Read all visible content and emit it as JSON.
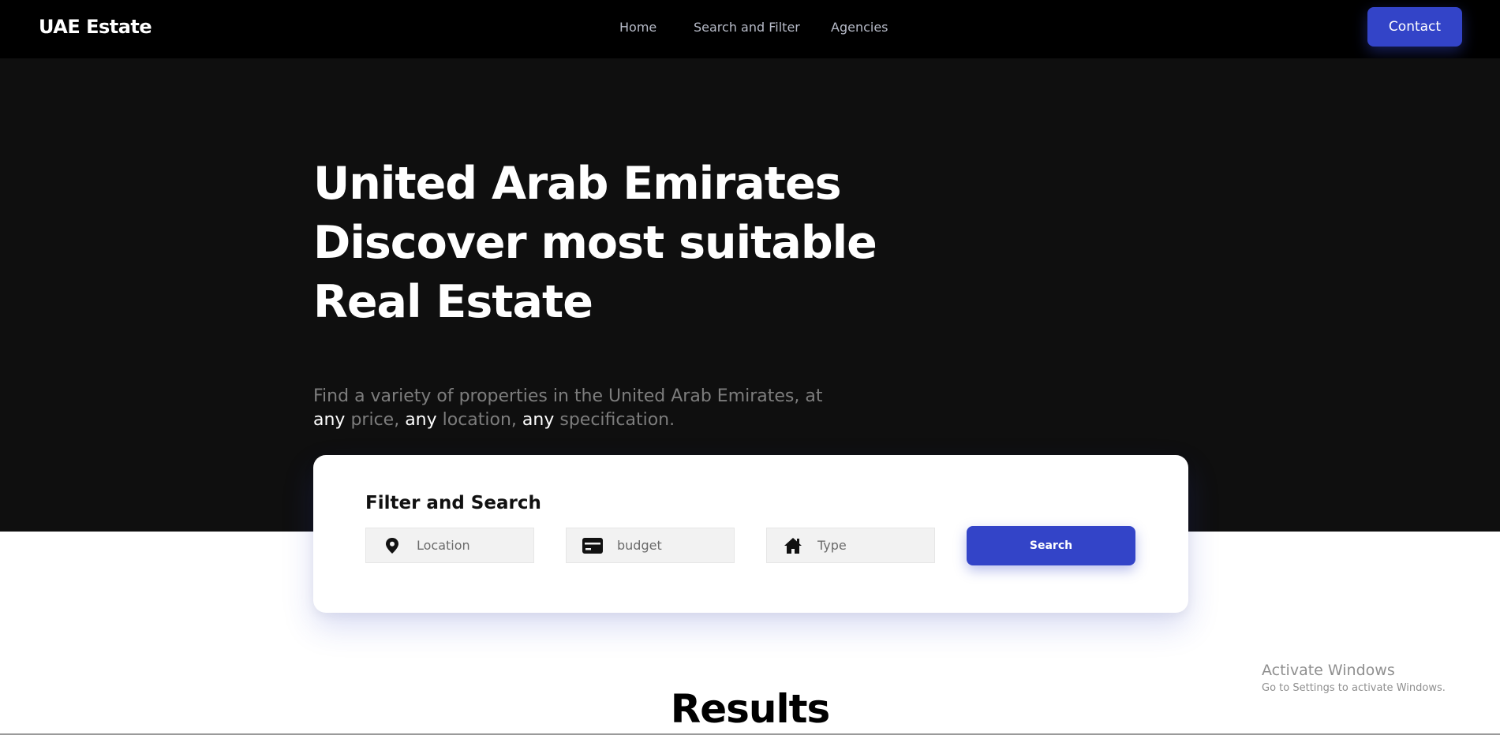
{
  "app": {
    "brand": "UAE Estate"
  },
  "nav": {
    "links": [
      {
        "label": "Home"
      },
      {
        "label": "Search and Filter"
      },
      {
        "label": "Agencies"
      }
    ],
    "contact_label": "Contact"
  },
  "hero": {
    "title_lines": [
      "United Arab Emirates",
      "Discover most suitable",
      "Real Estate"
    ],
    "subtitle": {
      "part1": "Find a variety of properties in the United Arab Emirates, at ",
      "hl1": "any",
      "part2": " price, ",
      "hl2": "any",
      "part3": " location, ",
      "hl3": "any",
      "part4": " specification."
    }
  },
  "filter": {
    "title": "Filter and Search",
    "fields": [
      {
        "placeholder": "Location",
        "icon": "location-pin-icon"
      },
      {
        "placeholder": "budget",
        "icon": "credit-card-icon"
      },
      {
        "placeholder": "Type",
        "icon": "house-icon"
      }
    ],
    "search_label": "Search"
  },
  "results": {
    "title": "Results"
  },
  "watermark": {
    "title": "Activate Windows",
    "subtitle": "Go to Settings to activate Windows."
  },
  "colors": {
    "accent": "#3344c8",
    "nav_bg": "#000000",
    "hero_bg": "#0f0f0f"
  }
}
